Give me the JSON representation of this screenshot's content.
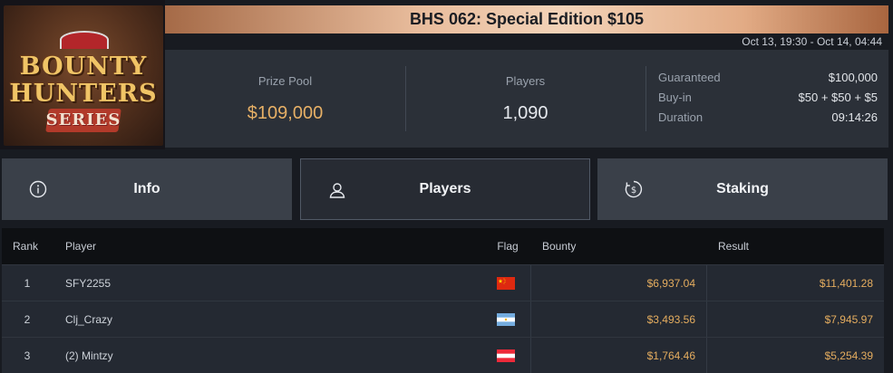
{
  "logo": {
    "line1": "BOUNTY",
    "line2": "HUNTERS",
    "line3": "SERIES"
  },
  "tournament": {
    "title": "BHS 062: Special Edition $105",
    "date_range": "Oct 13, 19:30 - Oct 14, 04:44"
  },
  "stats": {
    "prize_pool_label": "Prize Pool",
    "prize_pool_value": "$109,000",
    "players_label": "Players",
    "players_value": "1,090",
    "details": [
      {
        "label": "Guaranteed",
        "value": "$100,000"
      },
      {
        "label": "Buy-in",
        "value": "$50 + $50 + $5"
      },
      {
        "label": "Duration",
        "value": "09:14:26"
      }
    ]
  },
  "tabs": [
    {
      "label": "Info",
      "icon": "info-icon"
    },
    {
      "label": "Players",
      "icon": "user-icon",
      "active": true
    },
    {
      "label": "Staking",
      "icon": "dollar-coin-icon"
    }
  ],
  "table": {
    "headers": {
      "rank": "Rank",
      "player": "Player",
      "flag": "Flag",
      "bounty": "Bounty",
      "result": "Result"
    },
    "rows": [
      {
        "rank": "1",
        "player": "SFY2255",
        "flag": "china-flag-icon",
        "bounty": "$6,937.04",
        "result": "$11,401.28"
      },
      {
        "rank": "2",
        "player": "Clj_Crazy",
        "flag": "argentina-flag-icon",
        "bounty": "$3,493.56",
        "result": "$7,945.97"
      },
      {
        "rank": "3",
        "player": "(2) Mintzy",
        "flag": "austria-flag-icon",
        "bounty": "$1,764.46",
        "result": "$5,254.39"
      }
    ]
  },
  "colors": {
    "accent_gold": "#e5ad5f",
    "panel": "#2b3038",
    "background": "#181b21"
  }
}
